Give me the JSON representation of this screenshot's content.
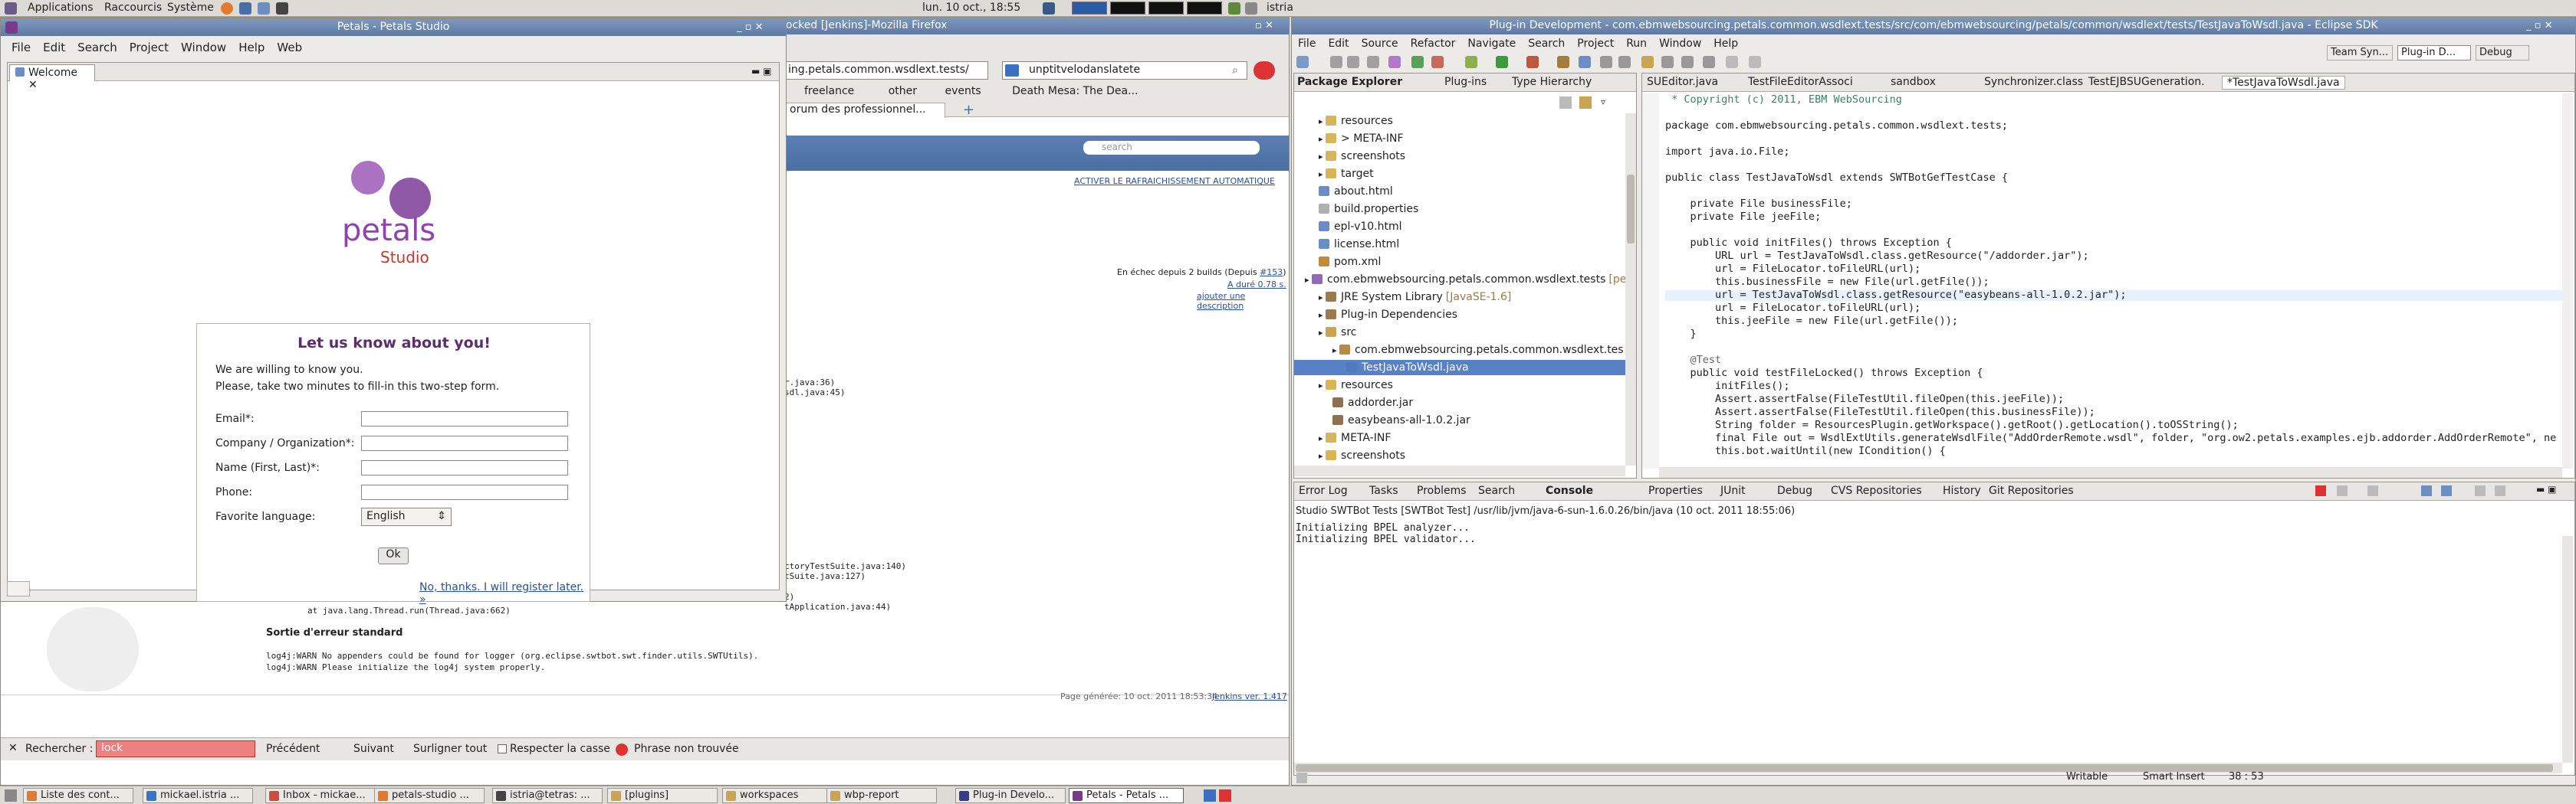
{
  "top_panel": {
    "applications": "Applications",
    "places": "Raccourcis",
    "system": "Système",
    "clock": "lun. 10 oct., 18:55",
    "user": "istria"
  },
  "firefox": {
    "title": "locked [Jenkins]-Mozilla Firefox",
    "url": "ing.petals.common.wsdlext.tests/",
    "search": "unptitvelodanslatete",
    "bookmarks": [
      "freelance",
      "other",
      "events",
      "Death Mesa: The Dea..."
    ],
    "tab": "orum des professionnel...",
    "jenkins_search_placeholder": "search",
    "refresh": "ACTIVER LE RAFRAICHISSEMENT AUTOMATIQUE",
    "failing": "En échec depuis 2 builds (Depuis",
    "build_num": "#153",
    "duration": "A duré 0.78 s.",
    "add_desc": "ajouter une description",
    "stack": [
      "r.java:36)",
      "sdl.java:45)",
      "ctoryTestSuite.java:140)",
      "tSuite.java:127)",
      "2)",
      "tApplication.java:44)",
      "at java.lang.Thread.run(Thread.java:662)"
    ],
    "stderr_title": "Sortie d'erreur standard",
    "stderr": [
      "log4j:WARN No appenders could be found for logger (org.eclipse.swtbot.swt.finder.utils.SWTUtils).",
      "log4j:WARN Please initialize the log4j system properly."
    ],
    "generated": "Page générée: 10 oct. 2011 18:53:34",
    "jenkins_ver": "Jenkins ver. 1.417",
    "find": {
      "label": "Rechercher :",
      "value": "lock",
      "prev": "Précédent",
      "next": "Suivant",
      "highlight": "Surligner tout",
      "case": "Respecter la casse",
      "notfound": "Phrase non trouvée"
    }
  },
  "petals": {
    "title": "Petals - Petals Studio",
    "menu": [
      "File",
      "Edit",
      "Search",
      "Project",
      "Window",
      "Help",
      "Web"
    ],
    "tab": "Welcome",
    "logo_word": "petals",
    "logo_sub": "Studio",
    "form": {
      "heading": "Let us know about you!",
      "intro1": "We are willing to know you.",
      "intro2": "Please, take two minutes to fill-in this two-step form.",
      "fields": [
        "Email*:",
        "Company / Organization*:",
        "Name (First, Last)*:",
        "Phone:"
      ],
      "lang_label": "Favorite language:",
      "lang_value": "English",
      "ok": "Ok",
      "skip": "No, thanks. I will register later. »"
    }
  },
  "eclipse": {
    "title": "Plug-in Development - com.ebmwebsourcing.petals.common.wsdlext.tests/src/com/ebmwebsourcing/petals/common/wsdlext/tests/TestJavaToWsdl.java - Eclipse SDK",
    "menu": [
      "File",
      "Edit",
      "Source",
      "Refactor",
      "Navigate",
      "Search",
      "Project",
      "Run",
      "Window",
      "Help"
    ],
    "perspectives": [
      "Team Syn...",
      "Plug-in D...",
      "Debug"
    ],
    "views": [
      "Package Explorer",
      "Plug-ins",
      "Type Hierarchy"
    ],
    "tree": [
      {
        "t": "resources",
        "d": 1,
        "c": "#d7b55a"
      },
      {
        "t": "> META-INF",
        "d": 1,
        "c": "#d7b55a"
      },
      {
        "t": "screenshots",
        "d": 1,
        "c": "#d7b55a"
      },
      {
        "t": "target",
        "d": 1,
        "c": "#d7b55a"
      },
      {
        "t": "about.html",
        "d": 1,
        "c": "#6a8cc7"
      },
      {
        "t": "build.properties",
        "d": 1,
        "c": "#b0b0b0"
      },
      {
        "t": "epl-v10.html",
        "d": 1,
        "c": "#6a8cc7"
      },
      {
        "t": "license.html",
        "d": 1,
        "c": "#6a8cc7"
      },
      {
        "t": "pom.xml",
        "d": 1,
        "c": "#c48a3a"
      },
      {
        "t": "com.ebmwebsourcing.petals.common.wsdlext.tests",
        "d": 0,
        "c": "#8f6bb5",
        "x": "[pe"
      },
      {
        "t": "JRE System Library",
        "d": 1,
        "c": "#9a7a4e",
        "x": "[JavaSE-1.6]"
      },
      {
        "t": "Plug-in Dependencies",
        "d": 1,
        "c": "#9a7a4e"
      },
      {
        "t": "src",
        "d": 1,
        "c": "#c9a451"
      },
      {
        "t": "com.ebmwebsourcing.petals.common.wsdlext.tes",
        "d": 2,
        "c": "#b58b4c"
      },
      {
        "t": "TestJavaToWsdl.java",
        "d": 3,
        "c": "#4f7bbd",
        "sel": true
      },
      {
        "t": "resources",
        "d": 1,
        "c": "#d7b55a"
      },
      {
        "t": "addorder.jar",
        "d": 2,
        "c": "#8f7050"
      },
      {
        "t": "easybeans-all-1.0.2.jar",
        "d": 2,
        "c": "#8f7050"
      },
      {
        "t": "META-INF",
        "d": 1,
        "c": "#d7b55a"
      },
      {
        "t": "screenshots",
        "d": 1,
        "c": "#d7b55a"
      }
    ],
    "editor_tabs": [
      "SUEditor.java",
      "TestFileEditorAssoci",
      "sandbox",
      "Synchronizer.class",
      "TestEJBSUGeneration.",
      "*TestJavaToWsdl.java"
    ],
    "code": [
      " * Copyright (c) 2011, EBM WebSourcing",
      "",
      "package com.ebmwebsourcing.petals.common.wsdlext.tests;",
      "",
      "import java.io.File;",
      "",
      "public class TestJavaToWsdl extends SWTBotGefTestCase {",
      "",
      "    private File businessFile;",
      "    private File jeeFile;",
      "",
      "    public void initFiles() throws Exception {",
      "        URL url = TestJavaToWsdl.class.getResource(\"/addorder.jar\");",
      "        url = FileLocator.toFileURL(url);",
      "        this.businessFile = new File(url.getFile());",
      "        url = TestJavaToWsdl.class.getResource(\"easybeans-all-1.0.2.jar\");",
      "        url = FileLocator.toFileURL(url);",
      "        this.jeeFile = new File(url.getFile());",
      "    }",
      "",
      "    @Test",
      "    public void testFileLocked() throws Exception {",
      "        initFiles();",
      "        Assert.assertFalse(FileTestUtil.fileOpen(this.jeeFile));",
      "        Assert.assertFalse(FileTestUtil.fileOpen(this.businessFile));",
      "        String folder = ResourcesPlugin.getWorkspace().getRoot().getLocation().toOSString();",
      "        final File out = WsdlExtUtils.generateWsdlFile(\"AddOrderRemote.wsdl\", folder, \"org.ow2.petals.examples.ejb.addorder.AddOrderRemote\", ne",
      "        this.bot.waitUntil(new ICondition() {"
    ],
    "bottom_tabs": [
      "Error Log",
      "Tasks",
      "Problems",
      "Search",
      "Console",
      "Properties",
      "JUnit",
      "Debug",
      "CVS Repositories",
      "History",
      "Git Repositories"
    ],
    "console_header": "Studio SWTBot Tests [SWTBot Test] /usr/lib/jvm/java-6-sun-1.6.0.26/bin/java (10 oct. 2011 18:55:06)",
    "console": [
      "Initializing BPEL analyzer...",
      "Initializing BPEL validator..."
    ],
    "status": {
      "mode": "Writable",
      "insert": "Smart Insert",
      "pos": "38 : 53"
    }
  },
  "taskbar": [
    {
      "t": "Liste des cont...",
      "c": "#e27b2e"
    },
    {
      "t": "mickael.istria ...",
      "c": "#3b74c4"
    },
    {
      "t": "Inbox - mickae...",
      "c": "#d24a3c"
    },
    {
      "t": "petals-studio ...",
      "c": "#e27b2e"
    },
    {
      "t": "istria@tetras: ...",
      "c": "#444"
    },
    {
      "t": "[plugins]",
      "c": "#c9a451"
    },
    {
      "t": "workspaces",
      "c": "#c9a451"
    },
    {
      "t": "wbp-report",
      "c": "#c9a451"
    },
    {
      "t": "Plug-in Develo...",
      "c": "#3a3a8a"
    },
    {
      "t": "Petals - Petals ...",
      "c": "#7a3a8a"
    }
  ]
}
